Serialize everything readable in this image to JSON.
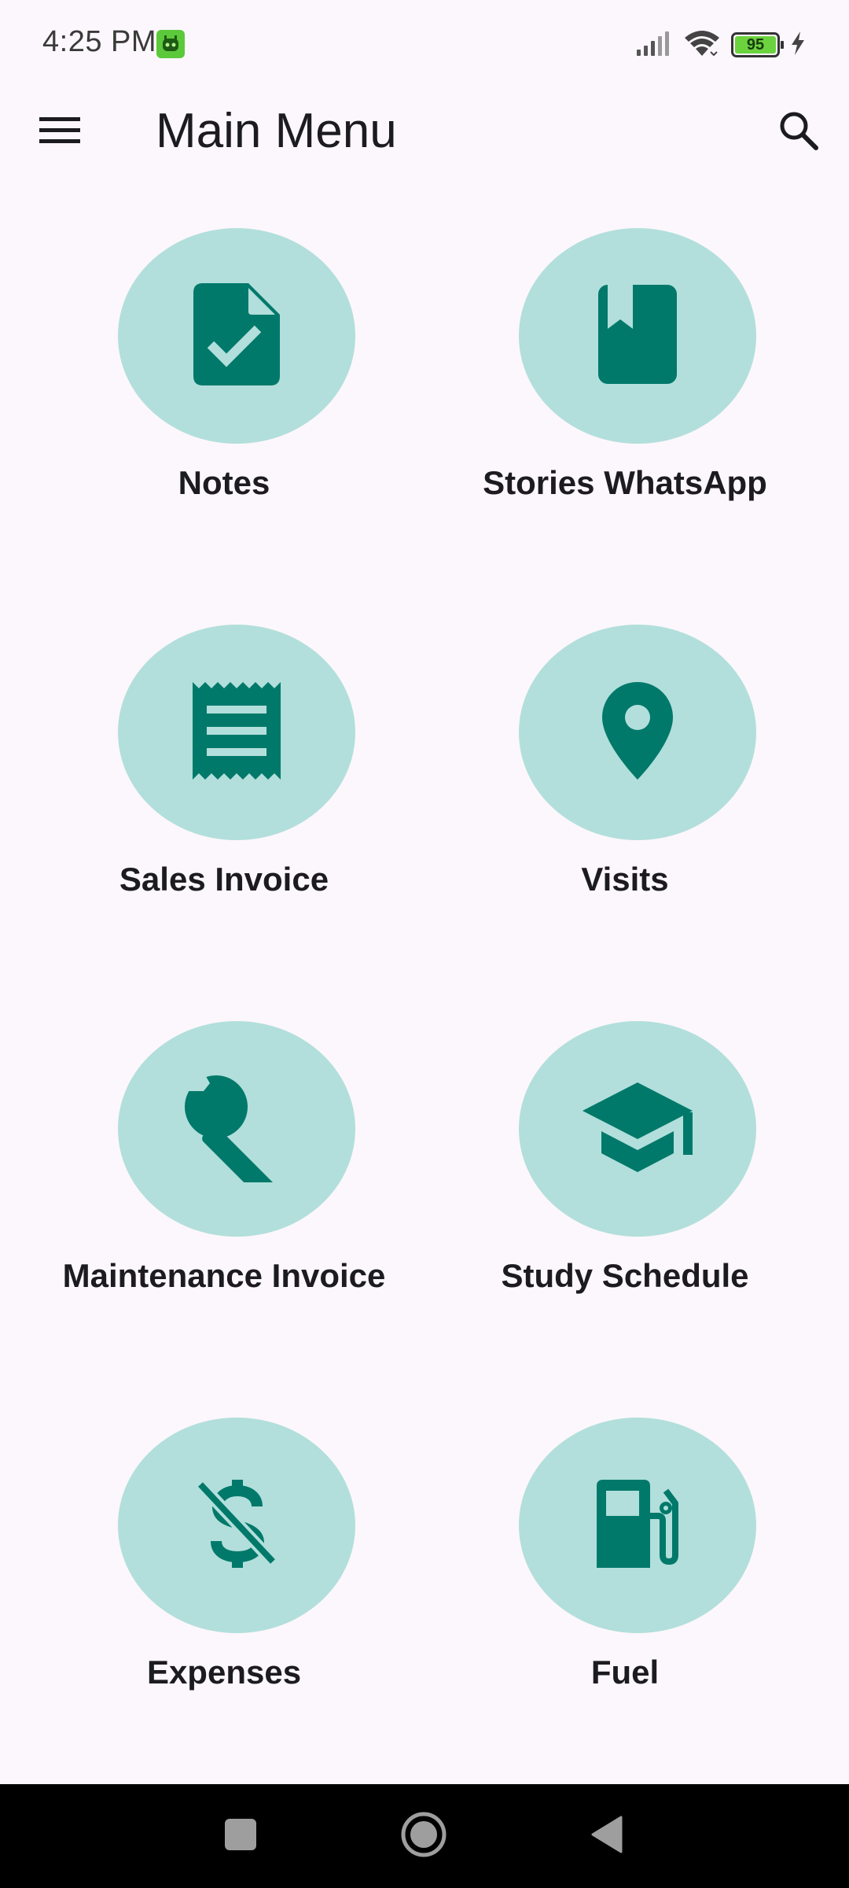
{
  "status_bar": {
    "time": "4:25 PM",
    "battery_level": "95",
    "icons": [
      "robot-app-icon",
      "signal-icon",
      "wifi-icon",
      "battery-icon",
      "charging-icon"
    ]
  },
  "app_bar": {
    "title": "Main Menu",
    "icons": [
      "menu-icon",
      "search-icon"
    ]
  },
  "menu": {
    "items": [
      {
        "label": "Notes",
        "icon": "note-check-icon"
      },
      {
        "label": "Stories WhatsApp",
        "icon": "book-bookmark-icon"
      },
      {
        "label": "Sales Invoice",
        "icon": "receipt-icon"
      },
      {
        "label": "Visits",
        "icon": "location-pin-icon"
      },
      {
        "label": "Maintenance Invoice",
        "icon": "wrench-icon"
      },
      {
        "label": "Study Schedule",
        "icon": "graduation-cap-icon"
      },
      {
        "label": "Expenses",
        "icon": "money-off-icon"
      },
      {
        "label": "Fuel",
        "icon": "fuel-pump-icon"
      }
    ]
  },
  "nav_bar": {
    "icons": [
      "recents-icon",
      "home-icon",
      "back-icon"
    ]
  },
  "colors": {
    "background": "#fcf7fc",
    "circle": "#b2dfdb",
    "icon": "#00796b",
    "text": "#1c1b1f",
    "nav_bar": "#000000",
    "battery_fill": "#6bd33e"
  }
}
